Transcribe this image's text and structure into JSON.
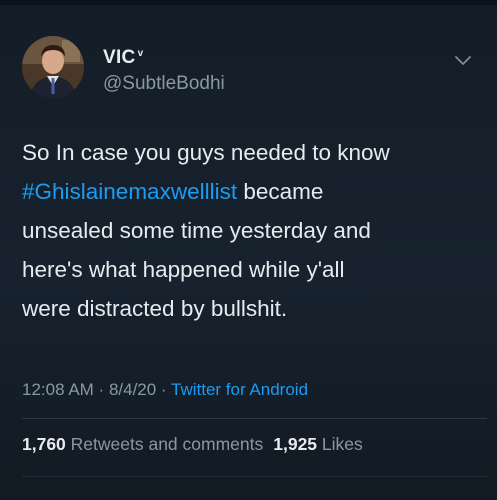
{
  "user": {
    "display_name": "VIC",
    "name_badge": "v",
    "handle": "@SubtleBodhi"
  },
  "tweet": {
    "line1": "So In case you guys needed to know",
    "hashtag": "#Ghislainemaxwelllist",
    "line2_rest": " became",
    "line3": "unsealed some time yesterday and",
    "line4": "here's what happened while y'all",
    "line5": "were distracted by bullshit."
  },
  "meta": {
    "time": "12:08 AM",
    "separator1": " · ",
    "date": "8/4/20",
    "separator2": " · ",
    "source": "Twitter for Android"
  },
  "stats": {
    "retweets_count": "1,760",
    "retweets_label": " Retweets and comments",
    "likes_count": "1,925",
    "likes_label": " Likes"
  },
  "icons": {
    "options": "chevron-down-icon",
    "avatar": "profile-photo"
  },
  "colors": {
    "background": "#15202b",
    "link": "#1d9bf0",
    "text": "#e7eaee",
    "muted": "#8a97a4"
  }
}
